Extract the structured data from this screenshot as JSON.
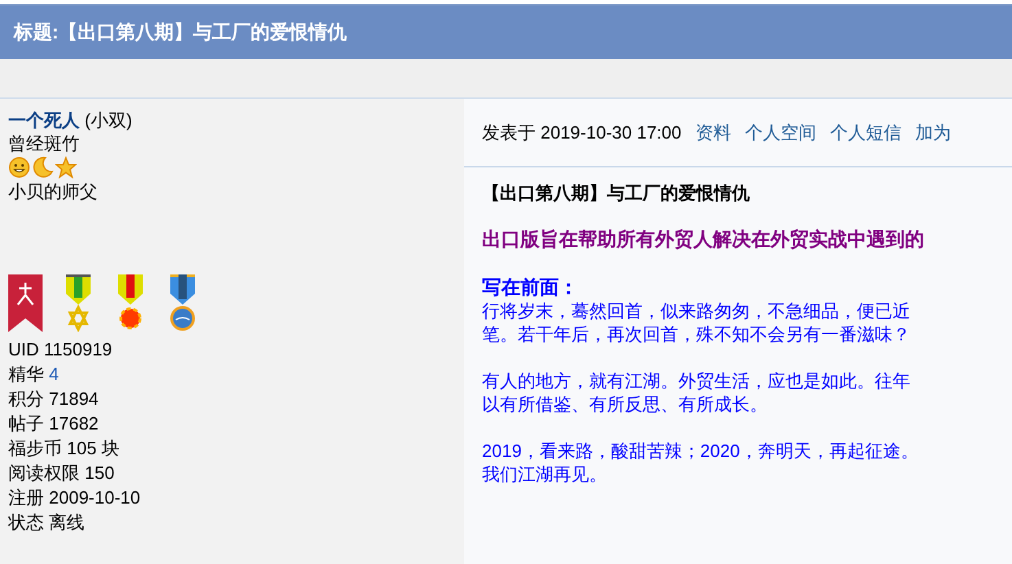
{
  "thread_title": "标题:【出口第八期】与工厂的爱恨情仇",
  "author": {
    "name": "一个死人",
    "nickname": "(小双)",
    "title": "曾经斑竹",
    "custom_title": "小贝的师父",
    "stats": [
      {
        "label": "UID",
        "value": "1150919",
        "link": false
      },
      {
        "label": "精华",
        "value": "4",
        "link": true
      },
      {
        "label": "积分",
        "value": "71894",
        "link": false
      },
      {
        "label": "帖子",
        "value": "17682",
        "link": false
      },
      {
        "label": "福步币",
        "value": "105 块",
        "link": false
      },
      {
        "label": "阅读权限",
        "value": "150",
        "link": false
      },
      {
        "label": "注册",
        "value": "2009-10-10",
        "link": false
      },
      {
        "label": "状态",
        "value": "离线",
        "link": false
      }
    ]
  },
  "post": {
    "posted": "发表于 2019-10-30 17:00",
    "links": [
      "资料",
      "个人空间",
      "个人短信",
      "加为"
    ],
    "body": [
      {
        "kind": "title",
        "lines": [
          "【出口第八期】与工厂的爱恨情仇"
        ]
      },
      {
        "kind": "lead",
        "lines": [
          "出口版旨在帮助所有外贸人解决在外贸实战中遇到的"
        ]
      },
      {
        "kind": "subhead",
        "lines": [
          "写在前面："
        ]
      },
      {
        "kind": "para",
        "lines": [
          "行将岁末，蓦然回首，似来路匆匆，不急细品，便已近",
          "笔。若干年后，再次回首，殊不知不会另有一番滋味？"
        ]
      },
      {
        "kind": "para",
        "lines": [
          "有人的地方，就有江湖。外贸生活，应也是如此。往年",
          "以有所借鉴、有所反思、有所成长。"
        ]
      },
      {
        "kind": "para",
        "lines": [
          "2019，看来路，酸甜苦辣；2020，奔明天，再起征途。",
          "我们江湖再见。"
        ]
      }
    ]
  }
}
